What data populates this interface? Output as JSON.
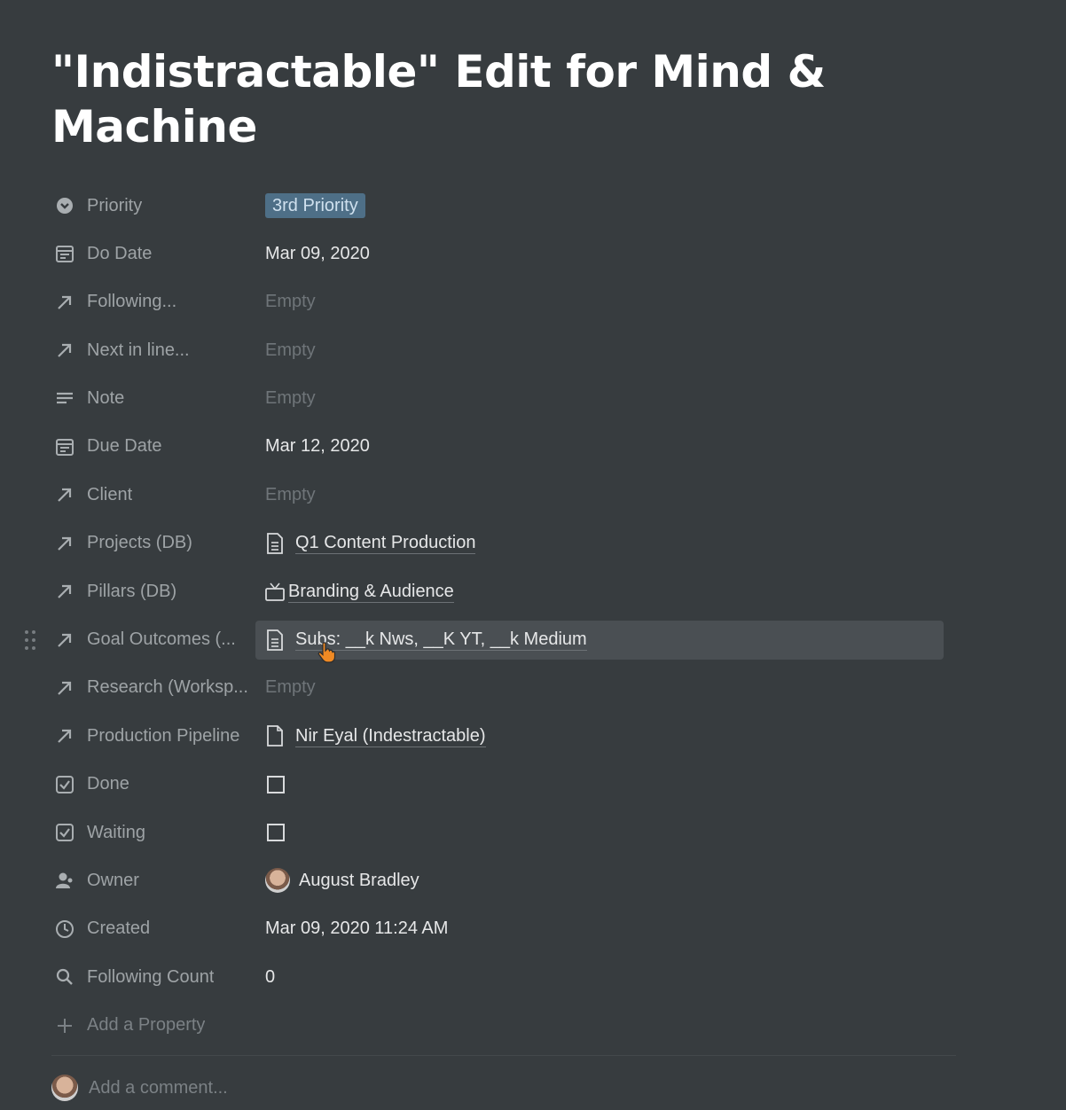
{
  "page": {
    "title": "\"Indistractable\" Edit for Mind & Machine"
  },
  "properties": [
    {
      "name": "Priority",
      "icon": "chevron-circle-icon",
      "value": "3rd Priority",
      "kind": "tag"
    },
    {
      "name": "Do Date",
      "icon": "calendar-icon",
      "value": "Mar 09, 2020",
      "kind": "text"
    },
    {
      "name": "Following...",
      "icon": "relation-arrow-icon",
      "value": "Empty",
      "kind": "empty"
    },
    {
      "name": "Next in line...",
      "icon": "relation-arrow-icon",
      "value": "Empty",
      "kind": "empty"
    },
    {
      "name": "Note",
      "icon": "text-lines-icon",
      "value": "Empty",
      "kind": "empty"
    },
    {
      "name": "Due Date",
      "icon": "calendar-icon",
      "value": "Mar 12, 2020",
      "kind": "text"
    },
    {
      "name": "Client",
      "icon": "relation-arrow-icon",
      "value": "Empty",
      "kind": "empty"
    },
    {
      "name": "Projects (DB)",
      "icon": "relation-arrow-icon",
      "value": "Q1 Content Production",
      "kind": "page"
    },
    {
      "name": "Pillars (DB)",
      "icon": "relation-arrow-icon",
      "value": "Branding & Audience",
      "kind": "page-tv"
    },
    {
      "name": "Goal Outcomes (...",
      "icon": "relation-arrow-icon",
      "value": "Subs: __k Nws, __K YT, __k Medium",
      "kind": "page-hover"
    },
    {
      "name": "Research (Worksp...",
      "icon": "relation-arrow-icon",
      "value": "Empty",
      "kind": "empty"
    },
    {
      "name": "Production Pipeline",
      "icon": "relation-arrow-icon",
      "value": "Nir Eyal (Indestractable)",
      "kind": "page-outline"
    },
    {
      "name": "Done",
      "icon": "checkbox-icon",
      "value": "",
      "kind": "checkbox"
    },
    {
      "name": "Waiting",
      "icon": "checkbox-icon",
      "value": "",
      "kind": "checkbox"
    },
    {
      "name": "Owner",
      "icon": "person-icon",
      "value": "August Bradley",
      "kind": "person"
    },
    {
      "name": "Created",
      "icon": "clock-icon",
      "value": "Mar 09, 2020 11:24 AM",
      "kind": "text"
    },
    {
      "name": "Following Count",
      "icon": "search-icon",
      "value": "0",
      "kind": "text"
    }
  ],
  "add_property": "Add a Property",
  "comment_placeholder": "Add a comment..."
}
